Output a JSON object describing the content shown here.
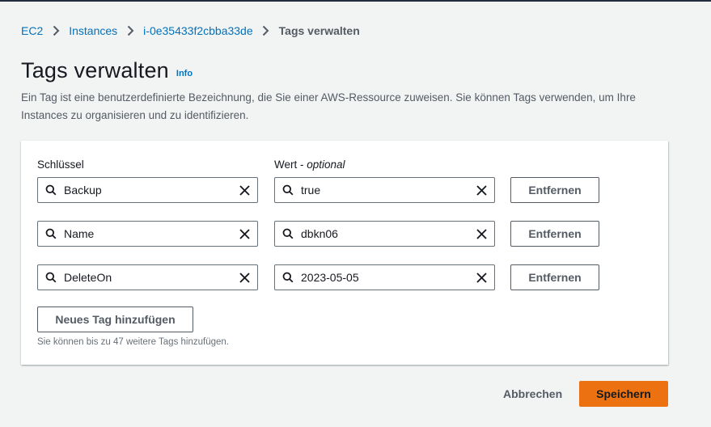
{
  "breadcrumb": {
    "items": [
      "EC2",
      "Instances",
      "i-0e35433f2cbba33de"
    ],
    "current": "Tags verwalten"
  },
  "header": {
    "title": "Tags verwalten",
    "info": "Info",
    "description": "Ein Tag ist eine benutzerdefinierte Bezeichnung, die Sie einer AWS-Ressource zuweisen. Sie können Tags verwenden, um Ihre Instances zu organisieren und zu identifizieren."
  },
  "tags": {
    "key_label": "Schlüssel",
    "value_label": "Wert - ",
    "value_label_optional": "optional",
    "rows": [
      {
        "key": "Backup",
        "value": "true",
        "remove_label": "Entfernen"
      },
      {
        "key": "Name",
        "value": "dbkn06",
        "remove_label": "Entfernen"
      },
      {
        "key": "DeleteOn",
        "value": "2023-05-05",
        "remove_label": "Entfernen"
      }
    ],
    "add_label": "Neues Tag hinzufügen",
    "hint": "Sie können bis zu 47 weitere Tags hinzufügen."
  },
  "footer": {
    "cancel_label": "Abbrechen",
    "save_label": "Speichern"
  },
  "colors": {
    "link": "#0073bb",
    "primary": "#ec7211",
    "background": "#f2f3f3"
  }
}
